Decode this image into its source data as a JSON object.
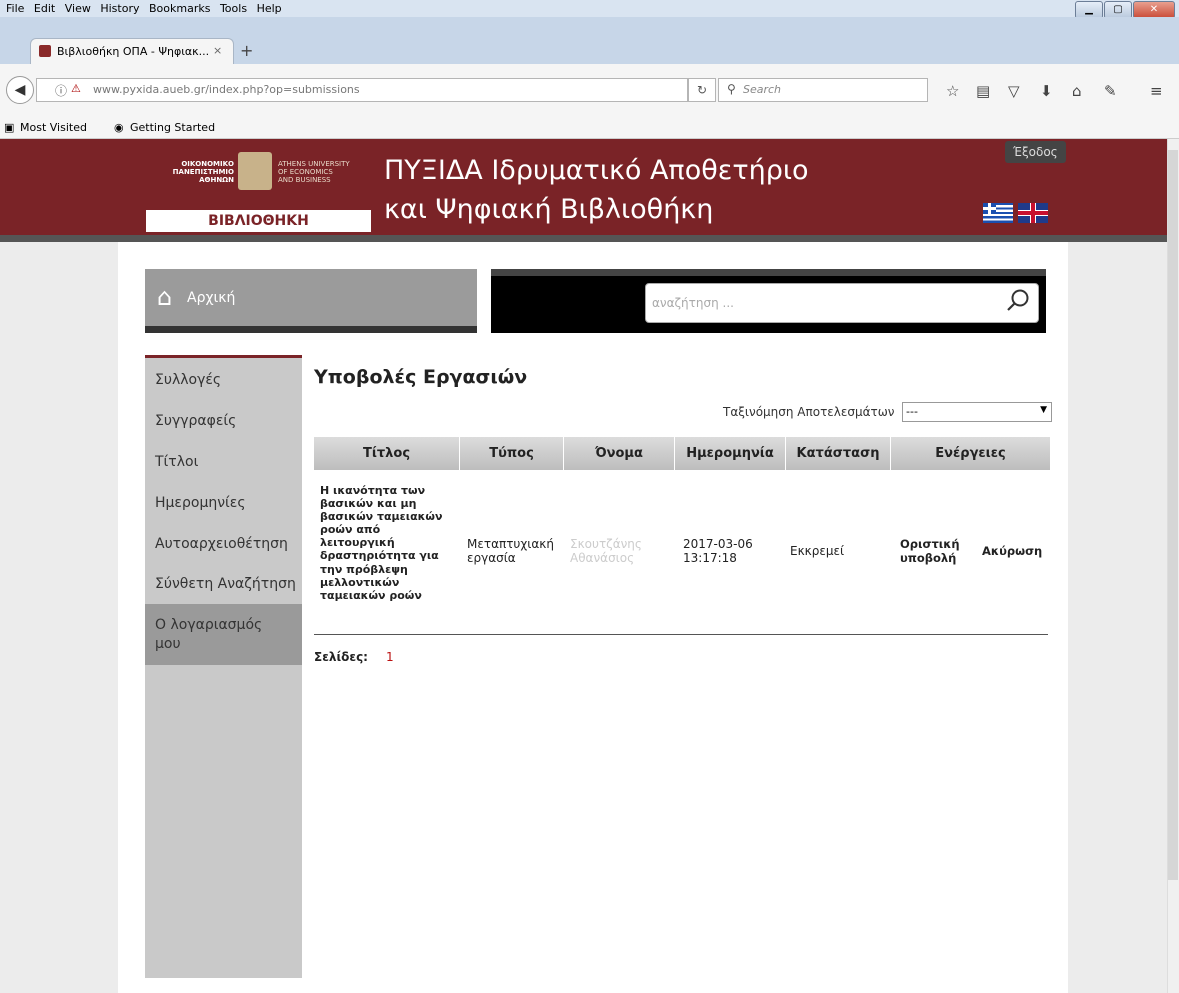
{
  "menu": [
    "File",
    "Edit",
    "View",
    "History",
    "Bookmarks",
    "Tools",
    "Help"
  ],
  "tab": {
    "title": "Βιβλιοθήκη ΟΠΑ - Ψηφιακ...",
    "close": "×",
    "new": "+"
  },
  "nav": {
    "url": "www.pyxida.aueb.gr/index.php?op=submissions",
    "search_placeholder": "Search"
  },
  "bookmarks": [
    "Most Visited",
    "Getting Started"
  ],
  "header": {
    "logo_gr": [
      "ΟΙΚΟΝΟΜΙΚΟ",
      "ΠΑΝΕΠΙΣΤΗΜΙΟ",
      "ΑΘΗΝΩΝ"
    ],
    "logo_en": [
      "ATHENS UNIVERSITY",
      "OF ECONOMICS",
      "AND BUSINESS"
    ],
    "library": "ΒΙΒΛΙΟΘΗΚΗ",
    "title_line1": "ΠΥΞΙΔΑ Ιδρυματικό Αποθετήριο",
    "title_line2": "και Ψηφιακή Βιβλιοθήκη",
    "exit": "Έξοδος"
  },
  "home": "Αρχική",
  "search": {
    "placeholder": "αναζήτηση ..."
  },
  "sidebar": [
    "Συλλογές",
    "Συγγραφείς",
    "Τίτλοι",
    "Ημερομηνίες",
    "Αυτοαρχειοθέτηση",
    "Σύνθετη Αναζήτηση",
    "Ο λογαριασμός μου"
  ],
  "main": {
    "title": "Υποβολές Εργασιών",
    "sort_label": "Ταξινόμηση Αποτελεσμάτων",
    "sort_value": "---",
    "columns": [
      "Τίτλος",
      "Τύπος",
      "Όνομα",
      "Ημερομηνία",
      "Κατάσταση",
      "Ενέργειες"
    ],
    "row": {
      "title_lines": [
        "Η ικανότητα των",
        "βασικών και μη",
        "βασικών ταμειακών",
        "ροών από",
        "λειτουργική",
        "δραστηριότητα για",
        "την πρόβλεψη",
        "μελλοντικών",
        "ταμειακών ροών"
      ],
      "type_lines": [
        "Μεταπτυχιακή",
        "εργασία"
      ],
      "name_lines": [
        "Σκουτζάνης",
        "Αθανάσιος"
      ],
      "date_lines": [
        "2017-03-06",
        "13:17:18"
      ],
      "status": "Εκκρεμεί",
      "final_lines": [
        "Οριστική",
        "υποβολή"
      ],
      "cancel": "Ακύρωση"
    },
    "pages_label": "Σελίδες:",
    "pages_value": "1"
  }
}
